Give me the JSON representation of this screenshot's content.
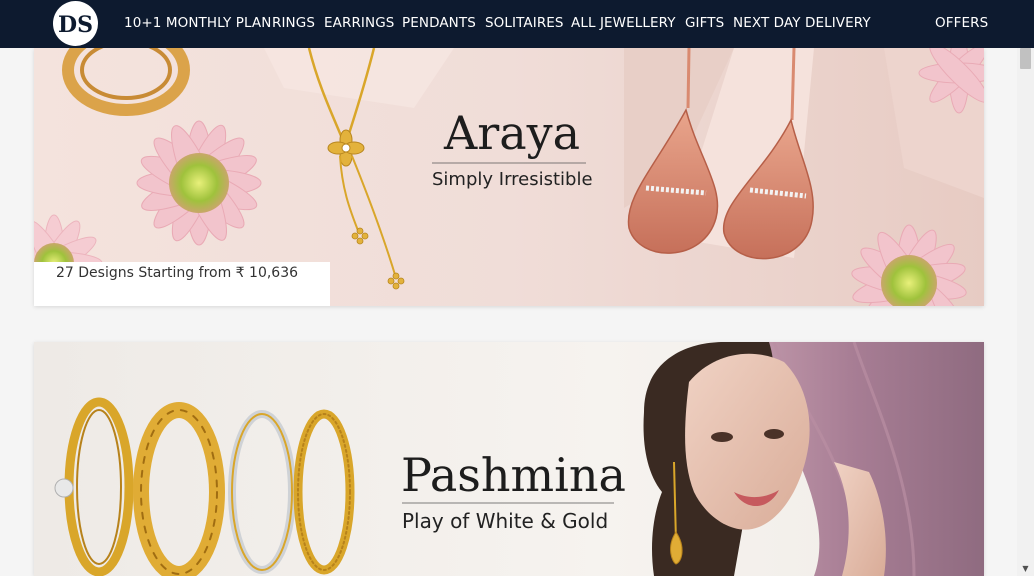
{
  "nav": {
    "items": [
      "10+1 MONTHLY PLAN",
      "RINGS",
      "EARRINGS",
      "PENDANTS",
      "SOLITAIRES",
      "ALL JEWELLERY",
      "GIFTS",
      "NEXT DAY DELIVERY"
    ],
    "offers": "OFFERS",
    "logo_text": "DS"
  },
  "banners": [
    {
      "title": "Araya",
      "subtitle": "Simply Irresistible",
      "info": "27 Designs Starting from ₹ 10,636"
    },
    {
      "title": "Pashmina",
      "subtitle": "Play of White & Gold"
    }
  ],
  "colors": {
    "navbar": "#0d1a2f",
    "nav_text": "#ffffff",
    "page_bg": "#f5f5f5",
    "banner1_bg": "#f0ddd8",
    "banner2_bg": "#f3efea",
    "gold": "#d9a62a",
    "rose_gold": "#d98a70",
    "flower_pink": "#f2c4cc",
    "curtain": "#a77d94"
  },
  "icons": {
    "logo": "ds-logo-icon",
    "scroll_up": "scroll-up-arrow-icon",
    "scroll_down": "scroll-down-arrow-icon"
  }
}
